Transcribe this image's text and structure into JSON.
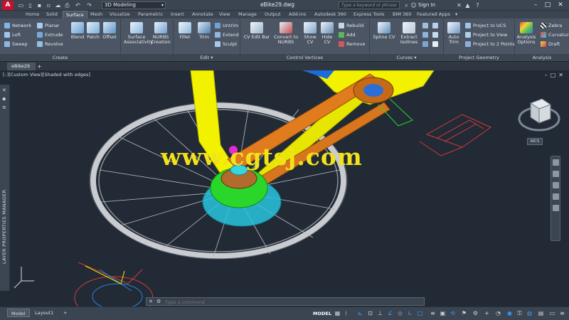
{
  "titlebar": {
    "logo": "A",
    "workspace": "3D Modeling",
    "file_title": "eBike29.dwg",
    "search_placeholder": "Type a keyword or phrase",
    "signin": "Sign In"
  },
  "ribbon_tabs": [
    "Home",
    "Solid",
    "Surface",
    "Mesh",
    "Visualize",
    "Parametric",
    "Insert",
    "Annotate",
    "View",
    "Manage",
    "Output",
    "Add-ins",
    "Autodesk 360",
    "Express Tools",
    "BIM 360",
    "Featured Apps"
  ],
  "ribbon_active_tab": "Surface",
  "ribbon": {
    "create": {
      "label": "Create",
      "small": [
        "Network",
        "Loft",
        "Sweep",
        "Planar",
        "Extrude",
        "Revolve"
      ],
      "large": [
        "Blend",
        "Patch",
        "Offset"
      ]
    },
    "surface_assoc": {
      "label1": "Surface",
      "label2": "Associativity"
    },
    "nurbs_creation": {
      "label1": "NURBS",
      "label2": "Creation"
    },
    "edit": {
      "label": "Edit",
      "large": [
        "Fillet",
        "Trim"
      ],
      "small": [
        "Untrim",
        "Extend",
        "Sculpt"
      ]
    },
    "control_vertices": {
      "label": "Control Vertices",
      "cv_edit_bar": "CV Edit Bar",
      "convert1": "Convert to",
      "convert2": "NURBS",
      "show_cv1": "Show",
      "show_cv2": "CV",
      "hide_cv1": "Hide",
      "hide_cv2": "CV",
      "small": [
        "Rebuild",
        "Add",
        "Remove"
      ]
    },
    "curves": {
      "label": "Curves",
      "spline_cv": "Spline CV",
      "extract1": "Extract",
      "extract2": "Isolines"
    },
    "project_geometry": {
      "label": "Project Geometry",
      "auto_trim1": "Auto",
      "auto_trim2": "Trim",
      "small": [
        "Project to UCS",
        "Project to View",
        "Project to 2 Points"
      ]
    },
    "analysis": {
      "label": "Analysis",
      "options1": "Analysis",
      "options2": "Options",
      "small": [
        "Zebra",
        "Curvature",
        "Draft"
      ]
    }
  },
  "file_tab": "eBike29",
  "viewport": {
    "label": "[–][Custom View][Shaded with edges]",
    "layer_panel": "LAYER PROPERTIES MANAGER",
    "wcs": "WCS",
    "watermark": "www.cgtsj.com"
  },
  "command_line": {
    "placeholder": "Type a command"
  },
  "statusbar": {
    "tabs": [
      "Model",
      "Layout1"
    ],
    "model_button": "MODEL"
  },
  "colors": {
    "accent": "#38a2ff",
    "watermark": "#f3e21b",
    "frame_yellow": "#f2f200",
    "chain_orange": "#e07b1e",
    "hub_green": "#2bd62b",
    "hub_cyan": "#25c8e0"
  }
}
